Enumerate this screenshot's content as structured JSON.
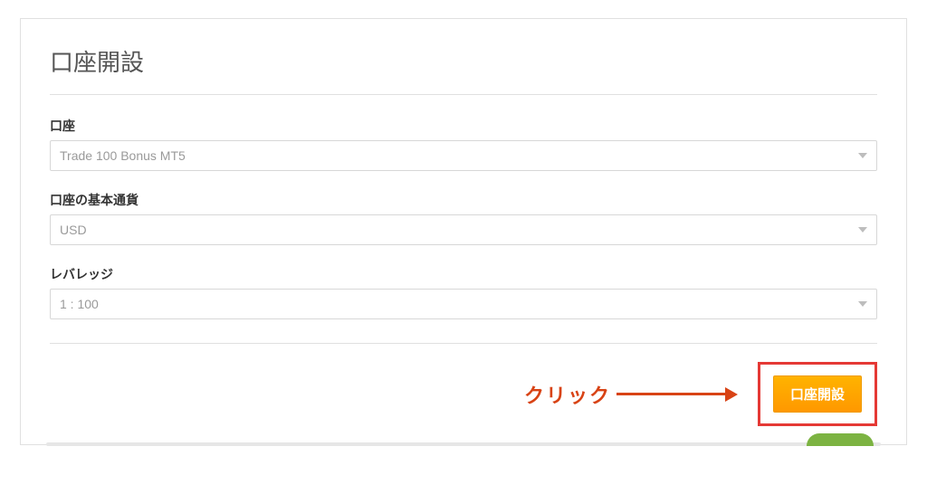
{
  "title": "口座開設",
  "fields": {
    "account": {
      "label": "口座",
      "value": "Trade 100 Bonus MT5"
    },
    "currency": {
      "label": "口座の基本通貨",
      "value": "USD"
    },
    "leverage": {
      "label": "レバレッジ",
      "value": "1 : 100"
    }
  },
  "annotation": "クリック",
  "submit_label": "口座開設"
}
